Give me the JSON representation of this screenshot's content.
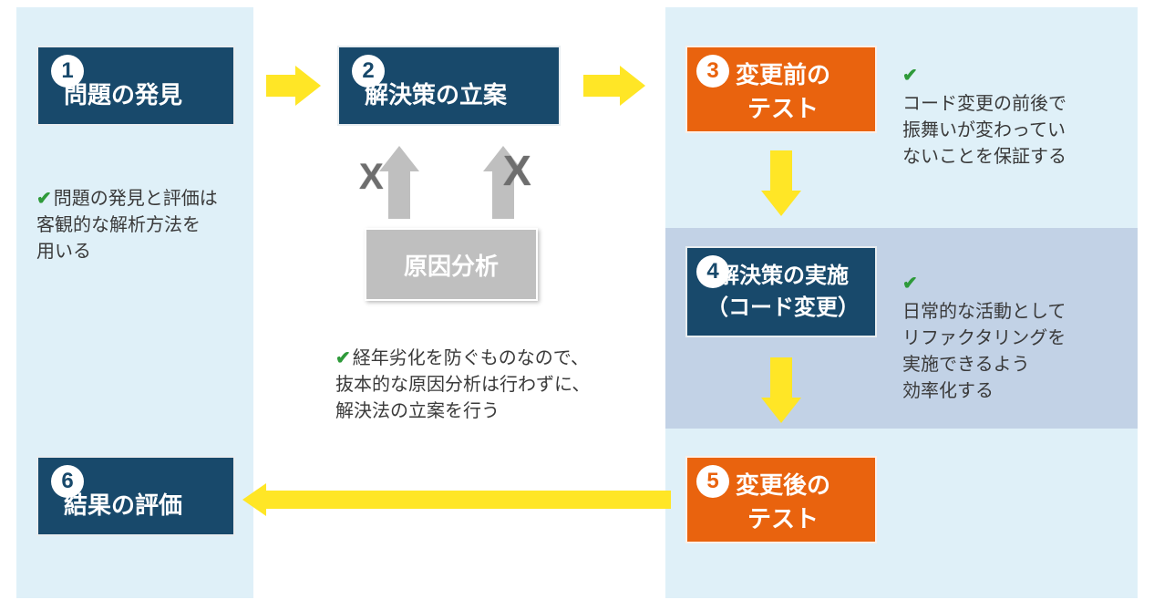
{
  "steps": {
    "s1": {
      "num": "1",
      "title": "問題の発見"
    },
    "s2": {
      "num": "2",
      "title": "解決策の立案"
    },
    "s3": {
      "num": "3",
      "title": "変更前の\nテスト"
    },
    "s4": {
      "num": "4",
      "title": "解決策の実施\n（コード変更）"
    },
    "s5": {
      "num": "5",
      "title": "変更後の\nテスト"
    },
    "s6": {
      "num": "6",
      "title": "結果の評価"
    }
  },
  "sub": {
    "cause": "原因分析"
  },
  "notes": {
    "n1": "問題の発見と評価は\n客観的な解析方法を\n用いる",
    "n_cause": "経年劣化を防ぐものなので、\n抜本的な原因分析は行わずに、\n解決法の立案を行う",
    "n3": "コード変更の前後で\n振舞いが変わってい\nないことを保証する",
    "n4": "日常的な活動として\nリファクタリングを\n実施できるよう\n効率化する"
  },
  "marks": {
    "check": "✔",
    "x": "X"
  }
}
